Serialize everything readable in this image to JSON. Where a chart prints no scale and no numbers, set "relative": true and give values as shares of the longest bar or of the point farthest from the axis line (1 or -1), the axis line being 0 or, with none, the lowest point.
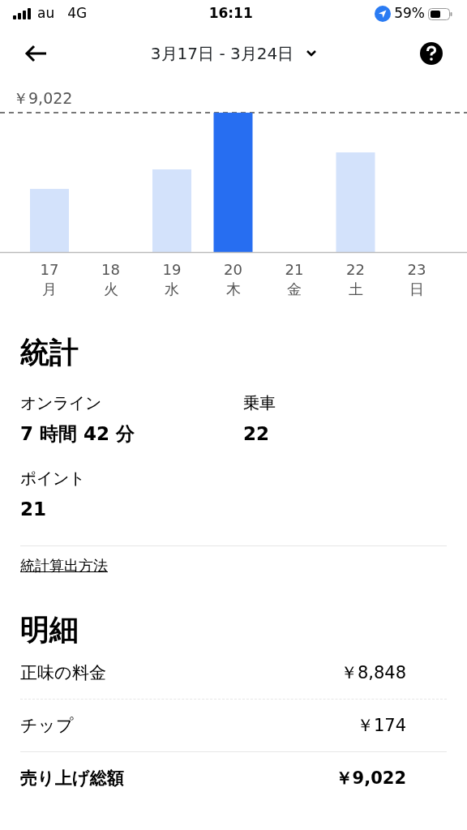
{
  "status_bar": {
    "carrier": "au",
    "network": "4G",
    "time": "16:11",
    "battery": "59%"
  },
  "header": {
    "title": "3月17日 - 3月24日"
  },
  "chart": {
    "chart_data": {
      "type": "bar",
      "categories": [
        "17\n月",
        "18\n火",
        "19\n水",
        "20\n木",
        "21\n金",
        "22\n土",
        "23\n日"
      ],
      "series": [
        {
          "color": "#d3e2fb",
          "values": [
            0.453,
            0,
            0.593,
            null,
            0,
            0.715,
            0
          ]
        },
        {
          "color": "#276ef1",
          "values": [
            null,
            null,
            null,
            1,
            null,
            null,
            null
          ]
        }
      ],
      "relative": true,
      "stacked": true,
      "annotations": [
        "￥9,022"
      ]
    }
  },
  "stats": {
    "title": "統計",
    "items": [
      {
        "label": "オンライン",
        "value": "7 時間 42 分"
      },
      {
        "label": "乗車",
        "value": "22"
      },
      {
        "label": "ポイント",
        "value": "21"
      }
    ],
    "link": "統計算出方法"
  },
  "breakdown": {
    "title": "明細",
    "rows": [
      {
        "kind": "item",
        "label": "正味の料金",
        "amount": "￥8,848"
      },
      {
        "kind": "item",
        "label": "チップ",
        "amount": "￥174"
      },
      {
        "kind": "total",
        "label": "売り上げ総額",
        "amount": "￥9,022"
      }
    ]
  }
}
